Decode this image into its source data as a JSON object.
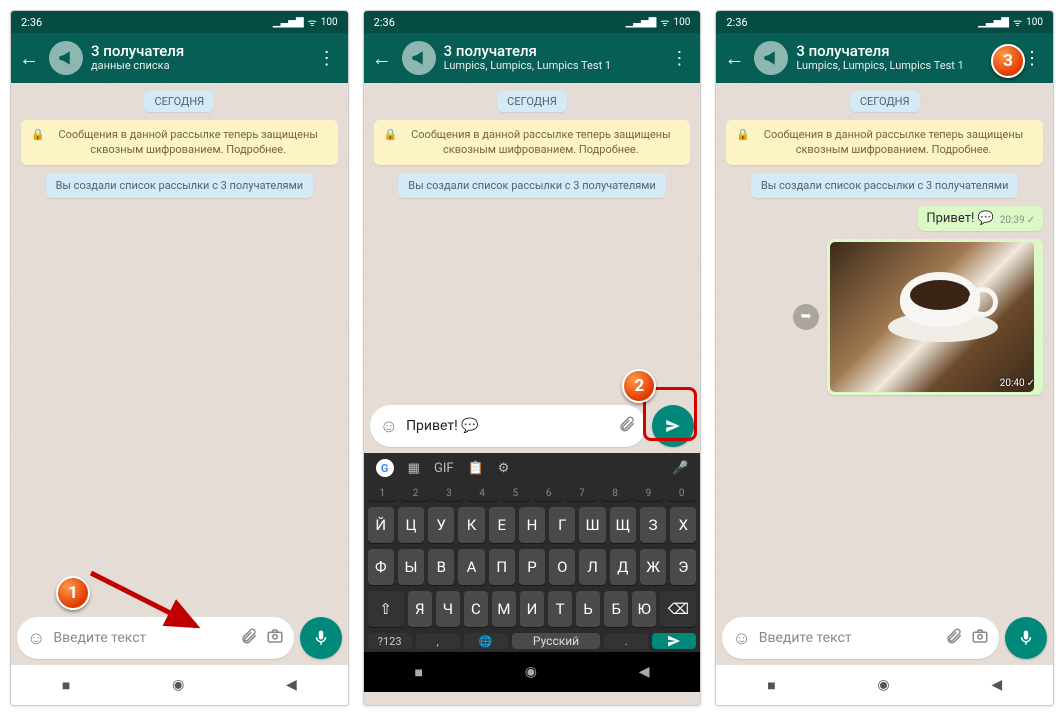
{
  "status": {
    "time": "2:36",
    "battery": "100"
  },
  "header": {
    "title": "3 получателя",
    "sub1": "данные списка",
    "sub2": "Lumpics, Lumpics, Lumpics Test 1"
  },
  "chips": {
    "today": "СЕГОДНЯ",
    "encryption": "Сообщения в данной рассылке теперь защищены сквозным шифрованием. Подробнее.",
    "created": "Вы создали список рассылки с 3 получателями"
  },
  "input": {
    "placeholder": "Введите текст",
    "typed": "Привет!"
  },
  "messages": {
    "hello": "Привет!",
    "hello_time": "20:39",
    "img_time": "20:40"
  },
  "keyboard": {
    "space_label": "Русский",
    "sym": "?123",
    "nums": [
      "1",
      "2",
      "3",
      "4",
      "5",
      "6",
      "7",
      "8",
      "9",
      "0"
    ],
    "row1": [
      "Й",
      "Ц",
      "У",
      "К",
      "Е",
      "Н",
      "Г",
      "Ш",
      "Щ",
      "З",
      "Х"
    ],
    "row2": [
      "Ф",
      "Ы",
      "В",
      "А",
      "П",
      "Р",
      "О",
      "Л",
      "Д",
      "Ж",
      "Э"
    ],
    "row3": [
      "Я",
      "Ч",
      "С",
      "М",
      "И",
      "Т",
      "Ь",
      "Б",
      "Ю"
    ],
    "gif": "GIF"
  },
  "steps": {
    "s1": "1",
    "s2": "2",
    "s3": "3"
  }
}
